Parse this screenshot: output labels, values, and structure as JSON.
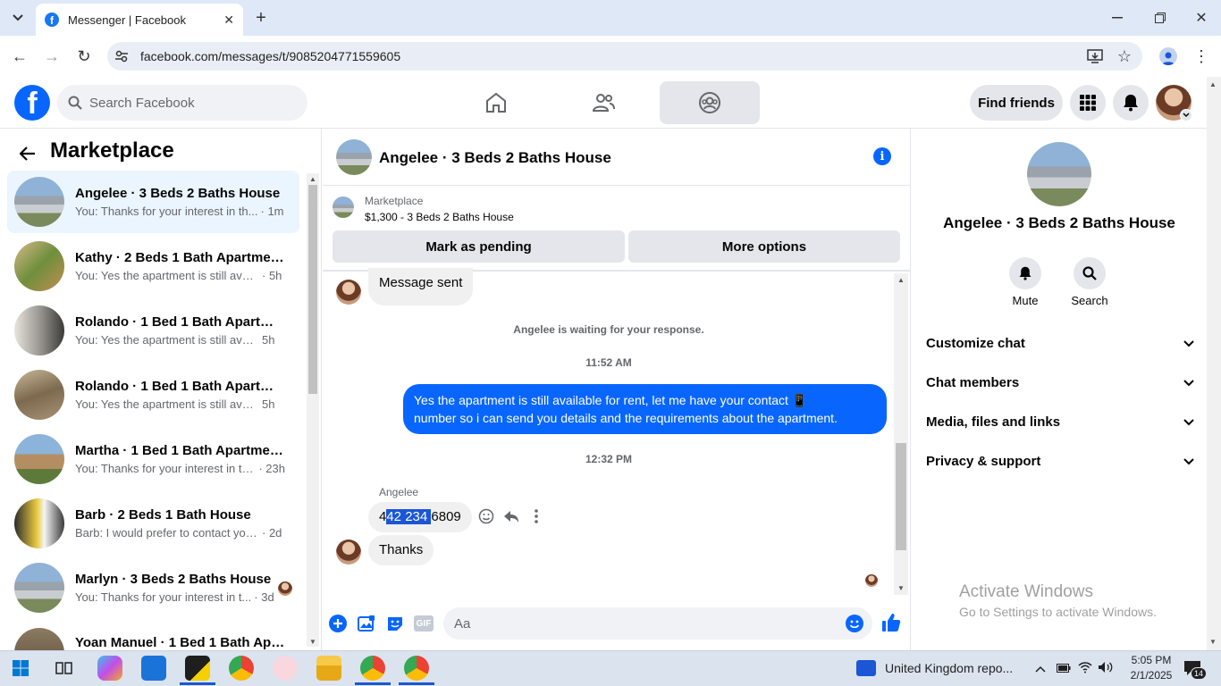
{
  "browser": {
    "tab_title": "Messenger | Facebook",
    "url": "facebook.com/messages/t/9085204771559605"
  },
  "header": {
    "logo": "f",
    "search_placeholder": "Search Facebook",
    "find_friends": "Find friends"
  },
  "left": {
    "title": "Marketplace",
    "conversations": [
      {
        "name": "Angelee · 3 Beds 2 Baths House",
        "preview": "You: Thanks for your interest in th...",
        "time": "· 1m",
        "active": true
      },
      {
        "name": "Kathy · 2 Beds 1 Bath Apartment...",
        "preview": "You: Yes the apartment is still avail...",
        "time": "· 5h"
      },
      {
        "name": "Rolando · 1 Bed 1 Bath Apartme...",
        "preview": "You: Yes the apartment is still availa...",
        "time": "5h"
      },
      {
        "name": "Rolando · 1 Bed 1 Bath Apartme...",
        "preview": "You: Yes the apartment is still availa...",
        "time": "5h"
      },
      {
        "name": "Martha · 1 Bed 1 Bath Apartmen...",
        "preview": "You: Thanks for your interest in th...",
        "time": "· 23h"
      },
      {
        "name": "Barb · 2 Beds 1 Bath House",
        "preview": "Barb: I would prefer to contact you...",
        "time": "· 2d"
      },
      {
        "name": "Marlyn · 3 Beds 2 Baths House",
        "preview": "You: Thanks for your interest in t...",
        "time": "· 3d"
      },
      {
        "name": "Yoan Manuel · 1 Bed 1 Bath Apar...",
        "preview": "",
        "time": ""
      }
    ]
  },
  "chat": {
    "title": "Angelee · 3 Beds 2 Baths House",
    "listing_label": "Marketplace",
    "listing_price": "$1,300 - 3 Beds 2 Baths House",
    "mark_pending": "Mark as pending",
    "more_options": "More options",
    "msg_sent": "Message sent",
    "waiting": "Angelee is waiting for your response.",
    "time1": "11:52 AM",
    "outgoing_line1": "Yes the apartment is still available for rent, let me have your contact 📱",
    "outgoing_line2": "number so i can send you details and the requirements about the  apartment.",
    "time2": "12:32 PM",
    "sender": "Angelee",
    "phone_a": "4",
    "phone_b": "42 234 ",
    "phone_c": "6809",
    "thanks": "Thanks",
    "composer_placeholder": "Aa"
  },
  "right": {
    "name": "Angelee · 3 Beds 2 Baths House",
    "mute": "Mute",
    "search": "Search",
    "sections": [
      "Customize chat",
      "Chat members",
      "Media, files and links",
      "Privacy & support"
    ]
  },
  "watermark": {
    "line1": "Activate Windows",
    "line2": "Go to Settings to activate Windows."
  },
  "taskbar": {
    "news": "United Kingdom repo...",
    "time": "5:05 PM",
    "date": "2/1/2025",
    "notif_count": "14"
  }
}
